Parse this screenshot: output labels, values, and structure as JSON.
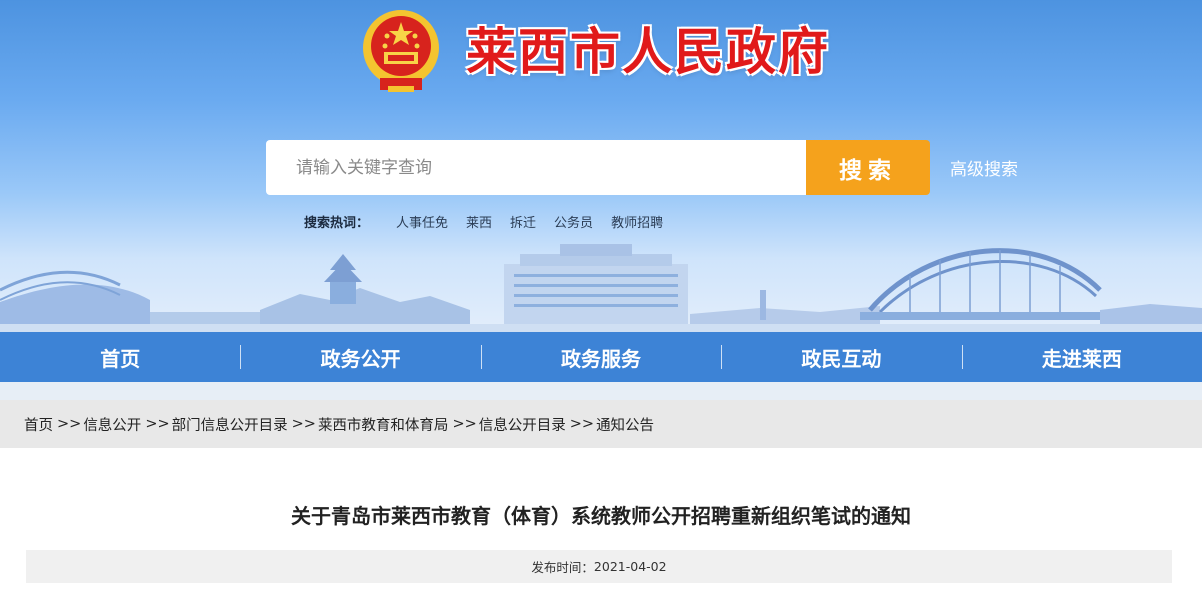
{
  "header": {
    "site_title": "莱西市人民政府",
    "emblem_icon": "national-emblem-icon",
    "colors": {
      "title": "#e11a1a",
      "banner_top": "#4d93e0",
      "banner_bottom": "#e3eefb"
    }
  },
  "search": {
    "placeholder": "请输入关键字查询",
    "button_label": "搜索",
    "button_color": "#f5a21c",
    "advanced_label": "高级搜索",
    "hot_label": "搜索热词：",
    "hot_terms": [
      "人事任免",
      "莱西",
      "拆迁",
      "公务员",
      "教师招聘"
    ]
  },
  "nav": {
    "color": "#3d83d6",
    "items": [
      "首页",
      "政务公开",
      "政务服务",
      "政民互动",
      "走进莱西"
    ]
  },
  "breadcrumb": {
    "items": [
      "首页",
      "信息公开",
      "部门信息公开目录",
      "莱西市教育和体育局",
      "信息公开目录",
      "通知公告"
    ],
    "separator": ">>"
  },
  "article": {
    "title": "关于青岛市莱西市教育（体育）系统教师公开招聘重新组织笔试的通知",
    "publish_label": "发布时间：",
    "publish_date": "2021-04-02"
  }
}
